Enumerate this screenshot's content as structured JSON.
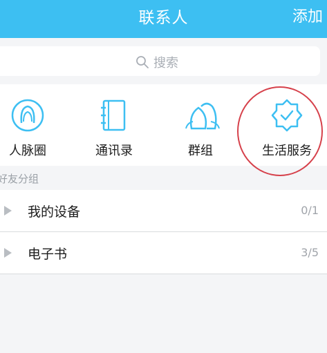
{
  "header": {
    "title": "联系人",
    "add_label": "添加"
  },
  "search": {
    "placeholder": "搜索",
    "icon": "search-icon"
  },
  "shortcuts": [
    {
      "label": "人脉圈",
      "icon": "contacts-circle-icon"
    },
    {
      "label": "通讯录",
      "icon": "address-book-icon"
    },
    {
      "label": "群组",
      "icon": "group-icon"
    },
    {
      "label": "生活服务",
      "icon": "badge-check-icon"
    }
  ],
  "friends_section": {
    "title": "好友分组"
  },
  "groups": [
    {
      "name": "我的设备",
      "count": "0/1"
    },
    {
      "name": "电子书",
      "count": "3/5"
    }
  ],
  "colors": {
    "accent": "#3dbff2",
    "annotation": "#d6414b"
  }
}
